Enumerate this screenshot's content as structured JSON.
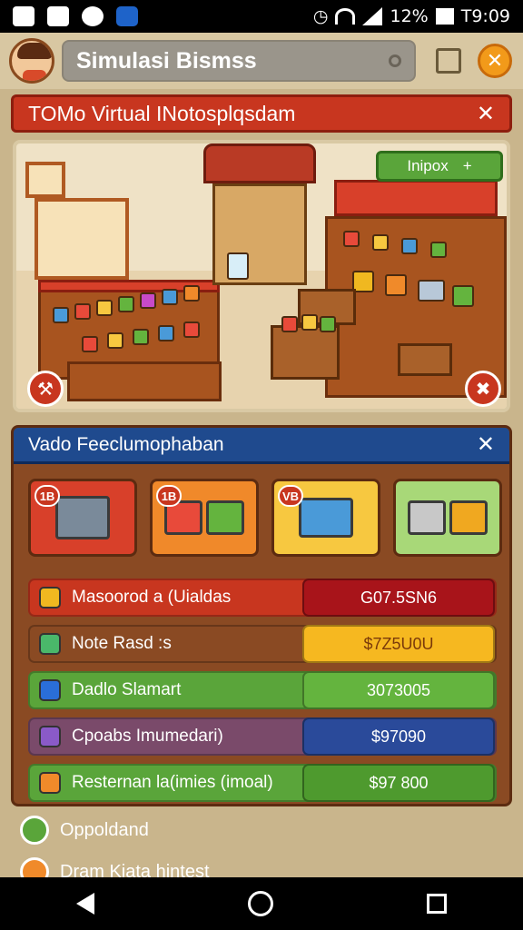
{
  "status_bar": {
    "battery_text": "12%",
    "time": "T9:09"
  },
  "header": {
    "title": "Simulasi Bismss"
  },
  "banner_top": {
    "title": "TOMo Virtual  INotosplqsdam"
  },
  "scene": {
    "inbox_label": "Inipox"
  },
  "panel": {
    "title": "Vado Feeclumophaban",
    "categories": [
      {
        "badge": "1B",
        "color": "#d8402a"
      },
      {
        "badge": "1B",
        "color": "#f0892a"
      },
      {
        "badge": "VB",
        "color": "#f7c840"
      },
      {
        "badge": "",
        "color": "#a8d878"
      }
    ],
    "rows": [
      {
        "label": "Masoorod a (Uialdas",
        "value": "G07.5SN6",
        "row_color": "#c8361f",
        "value_color": "#a8141a",
        "icon_color": "#f0b820"
      },
      {
        "label": "Note Rasd :s",
        "value": "$7Z5U0U",
        "row_color": "#8a4a23",
        "value_color": "#f6b820",
        "icon_color": "#4ab86a"
      },
      {
        "label": "Dadlo Slamart",
        "value": "3073005",
        "row_color": "#5aa53a",
        "value_color": "#64b43e",
        "icon_color": "#2a6ed8"
      },
      {
        "label": "Cpoabs Imumedari)",
        "value": "$97090",
        "row_color": "#7a4a6a",
        "value_color": "#2a4a9a",
        "icon_color": "#8a5ac8"
      },
      {
        "label": "Resternan la(imies (imoal)",
        "value": "$97 800",
        "row_color": "#5aa53a",
        "value_color": "#4e9a2e",
        "icon_color": "#f08a2a"
      }
    ]
  },
  "below_list": [
    {
      "label": "Oppoldand"
    },
    {
      "label": "Dram Kiata hintest"
    }
  ]
}
